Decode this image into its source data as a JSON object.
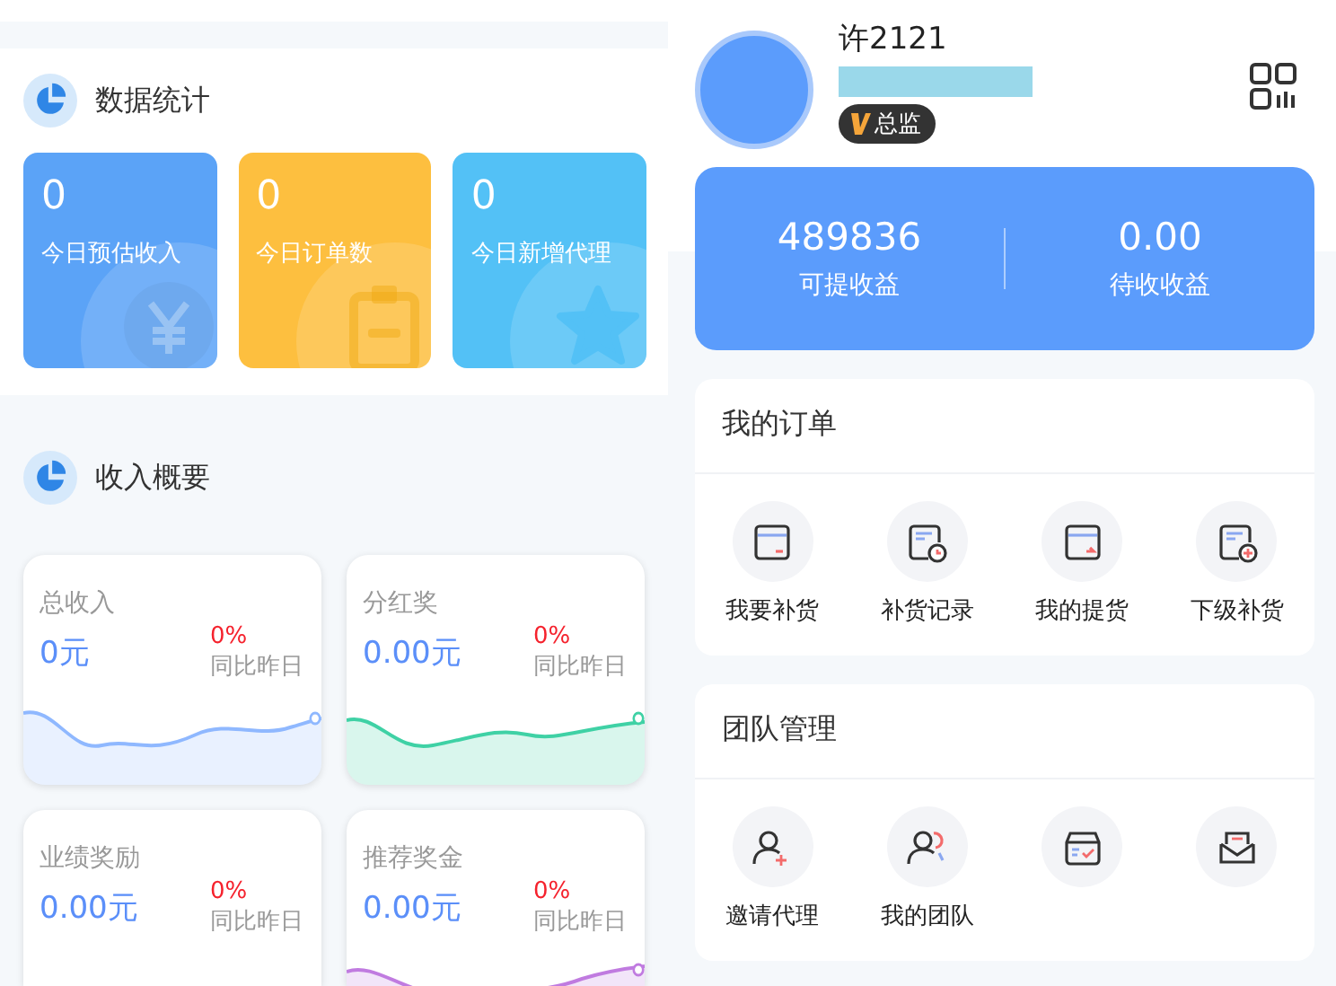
{
  "data_stats": {
    "title": "数据统计",
    "cards": [
      {
        "value": "0",
        "label": "今日预估收入",
        "color": "#5ba3f7",
        "kind": "yen"
      },
      {
        "value": "0",
        "label": "今日订单数",
        "color": "#fdbf3f",
        "kind": "clipboard"
      },
      {
        "value": "0",
        "label": "今日新增代理",
        "color": "#53c1f6",
        "kind": "star"
      }
    ]
  },
  "income_overview": {
    "title": "收入概要",
    "cards": [
      {
        "title": "总收入",
        "amount": "0元",
        "change": "0%",
        "compare": "同比昨日",
        "color": "#8fb8ff"
      },
      {
        "title": "分红奖",
        "amount": "0.00元",
        "change": "0%",
        "compare": "同比昨日",
        "color": "#3fd1a5"
      },
      {
        "title": "业绩奖励",
        "amount": "0.00元",
        "change": "0%",
        "compare": "同比昨日"
      },
      {
        "title": "推荐奖金",
        "amount": "0.00元",
        "change": "0%",
        "compare": "同比昨日",
        "color": "#c07be0"
      }
    ]
  },
  "profile": {
    "name": "许2121",
    "badge": "总监"
  },
  "earnings": [
    {
      "value": "489836",
      "label": "可提收益"
    },
    {
      "value": "0.00",
      "label": "待收收益"
    }
  ],
  "my_orders": {
    "title": "我的订单",
    "items": [
      {
        "label": "我要补货",
        "kind": "box-minus"
      },
      {
        "label": "补货记录",
        "kind": "doc-clock"
      },
      {
        "label": "我的提货",
        "kind": "box-arrow"
      },
      {
        "label": "下级补货",
        "kind": "doc-plus"
      }
    ]
  },
  "team": {
    "title": "团队管理",
    "items": [
      {
        "label": "邀请代理",
        "kind": "user-plus"
      },
      {
        "label": "我的团队",
        "kind": "users"
      },
      {
        "kind": "tray"
      },
      {
        "kind": "mail"
      }
    ]
  }
}
